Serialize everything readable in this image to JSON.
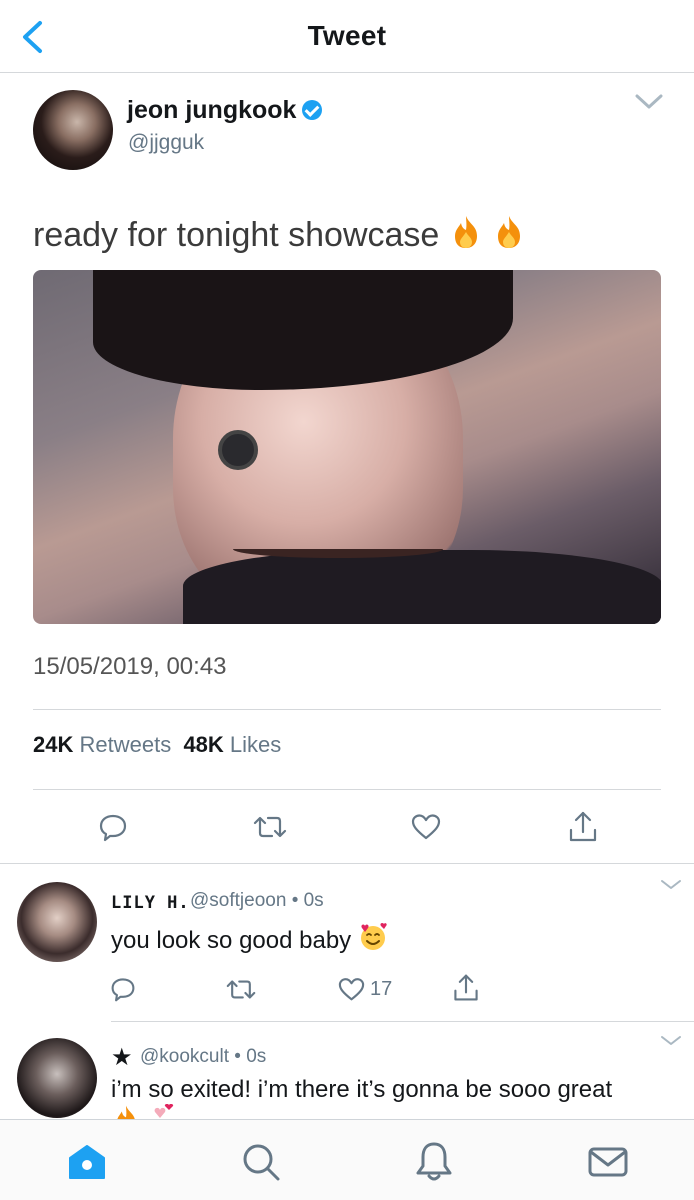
{
  "topbar": {
    "title": "Tweet"
  },
  "tweet": {
    "author_name": "jeon jungkook",
    "author_handle": "@jjgguk",
    "text": "ready for tonight showcase",
    "timestamp": "15/05/2019, 00:43",
    "retweets_count": "24K",
    "retweets_label": "Retweets",
    "likes_count": "48K",
    "likes_label": "Likes"
  },
  "replies": [
    {
      "name": "LILY H.",
      "handle": "@softjeoon",
      "time": "• 0s",
      "text": "you look so good baby",
      "like_count": "17"
    },
    {
      "name": "★",
      "handle": "@kookcult",
      "time": "• 0s",
      "text": "i’m so exited! i’m there it’s gonna be sooo great"
    }
  ],
  "icons": {
    "back": "chevron-left-icon",
    "reply": "speech-bubble-icon",
    "retweet": "retweet-icon",
    "like": "heart-icon",
    "share": "share-icon",
    "nav": [
      "home-icon",
      "search-icon",
      "bell-icon",
      "mail-icon"
    ]
  },
  "colors": {
    "accent": "#1da1f2",
    "nav_active": "#1da1f2",
    "muted": "#657786"
  }
}
